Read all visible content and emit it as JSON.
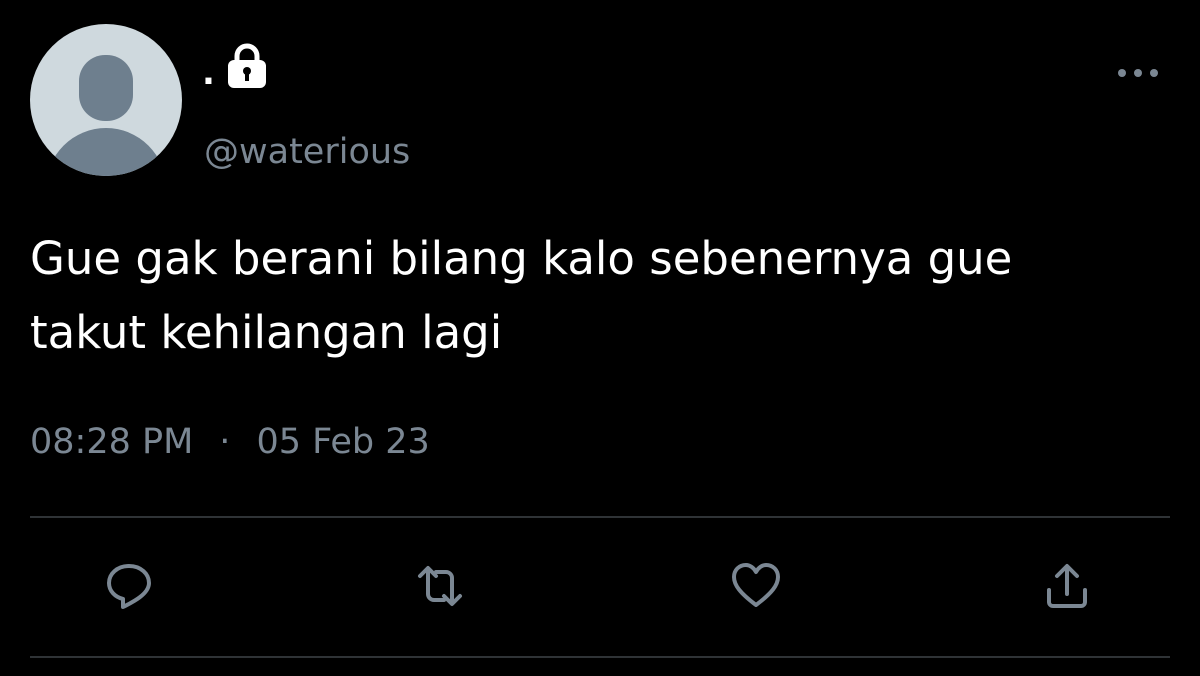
{
  "tweet": {
    "display_name": ".",
    "handle": "@waterious",
    "protected": true,
    "text": "Gue gak berani bilang kalo sebenernya gue\ntakut kehilangan lagi",
    "time": "08:28 PM",
    "separator": "·",
    "date": "05 Feb 23"
  },
  "icons": {
    "lock": "lock-icon",
    "more": "more-icon",
    "reply": "reply-icon",
    "retweet": "retweet-icon",
    "like": "heart-icon",
    "share": "share-icon"
  },
  "colors": {
    "background": "#000000",
    "text_primary": "#ffffff",
    "text_secondary": "#7b8793",
    "avatar_bg": "#cfd9de",
    "avatar_fg": "#6e7f8e",
    "divider": "#2f3336"
  }
}
